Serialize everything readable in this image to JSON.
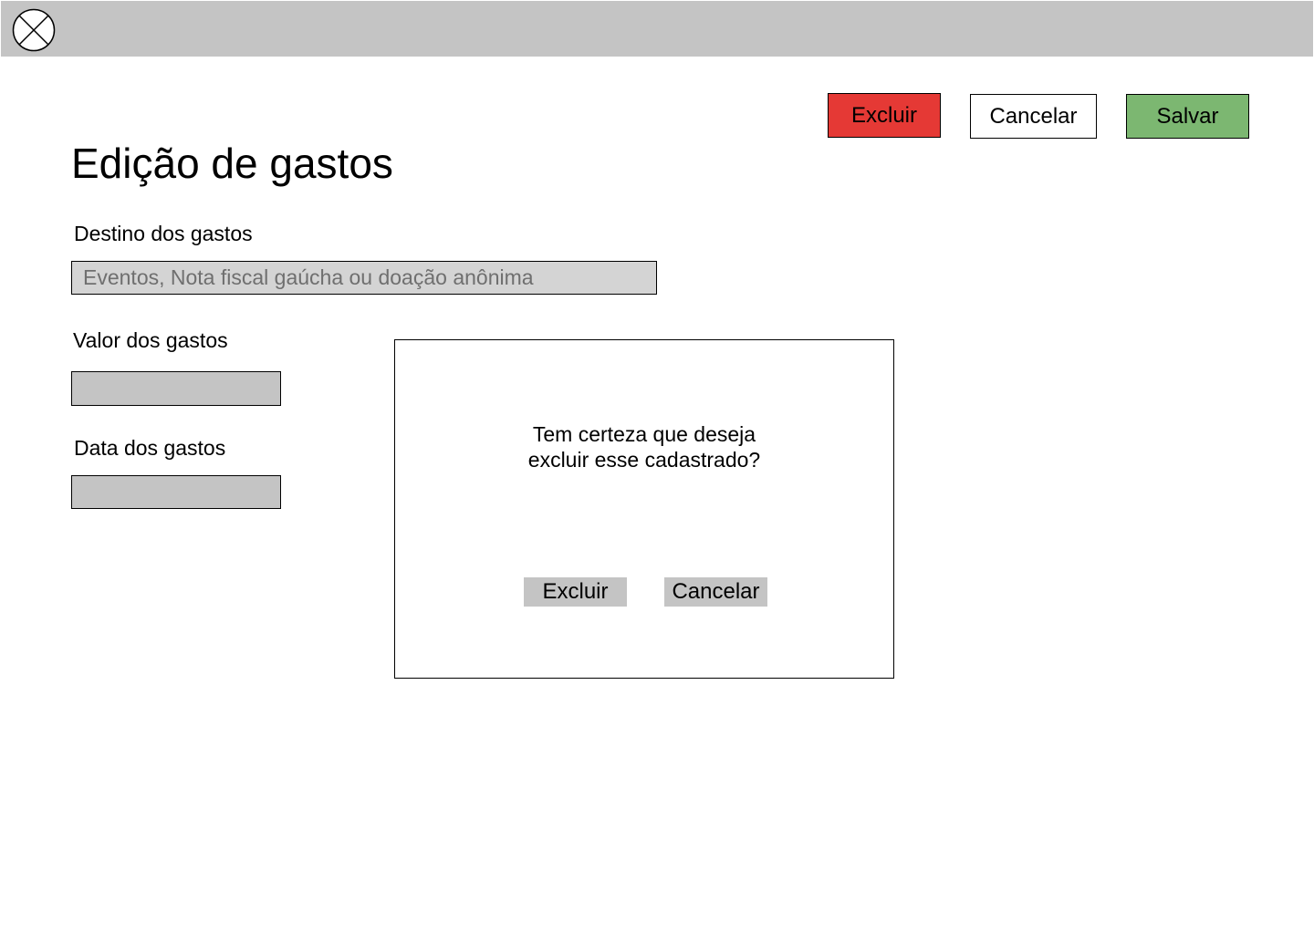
{
  "header": {
    "logo_icon": "circle-x-icon",
    "background_color": "#c4c4c4"
  },
  "toolbar": {
    "delete_label": "Excluir",
    "cancel_label": "Cancelar",
    "save_label": "Salvar",
    "delete_color": "#e53935",
    "save_color": "#7cb771"
  },
  "page": {
    "title": "Edição de gastos"
  },
  "form": {
    "destino": {
      "label": "Destino dos gastos",
      "value": "",
      "placeholder": "Eventos, Nota fiscal gaúcha ou doação anônima"
    },
    "valor": {
      "label": "Valor dos gastos",
      "value": "",
      "placeholder": ""
    },
    "data": {
      "label": "Data dos gastos",
      "value": "",
      "placeholder": ""
    }
  },
  "modal": {
    "message_line1": "Tem certeza que deseja",
    "message_line2": "excluir esse cadastrado?",
    "confirm_label": "Excluir",
    "cancel_label": "Cancelar"
  }
}
